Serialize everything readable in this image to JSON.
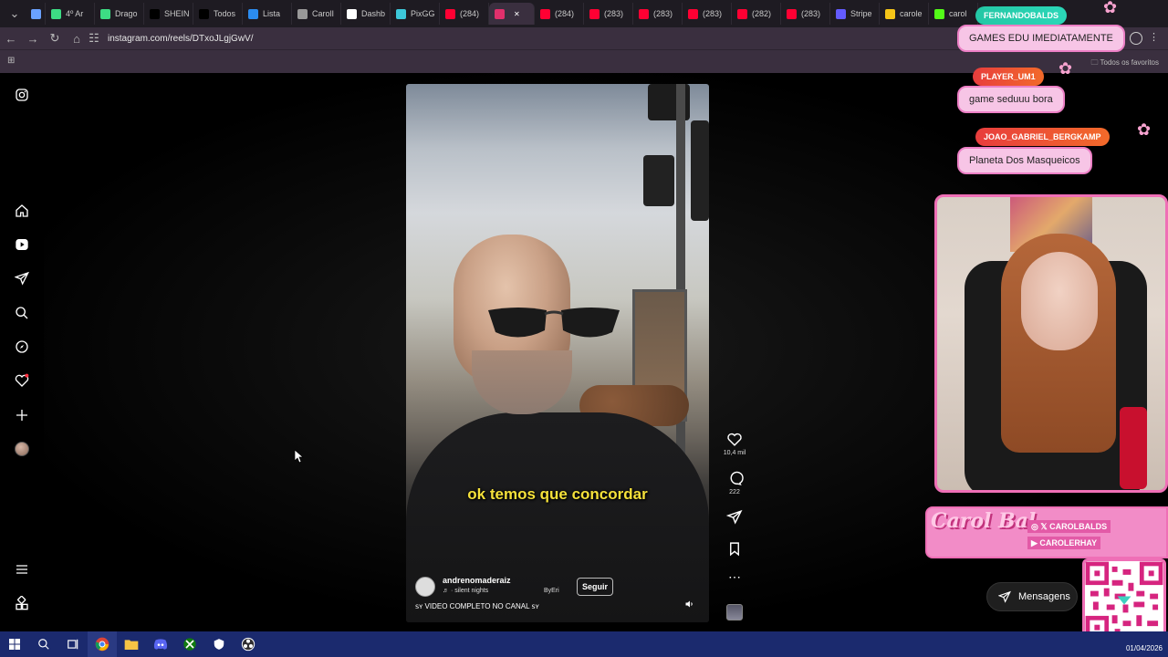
{
  "browser": {
    "tabs": [
      {
        "label": "",
        "color": "#6aa2ff"
      },
      {
        "label": "4º Ar",
        "color": "#3ddc84"
      },
      {
        "label": "Drago",
        "color": "#3ddc84"
      },
      {
        "label": "SHEIN",
        "color": "#000000"
      },
      {
        "label": "Todos",
        "color": "#000000"
      },
      {
        "label": "Lista",
        "color": "#2b8cf0"
      },
      {
        "label": "CarolI",
        "color": "#999999"
      },
      {
        "label": "Dashb",
        "color": "#ffffff"
      },
      {
        "label": "PixGG",
        "color": "#3dc7d9"
      },
      {
        "label": "(284)",
        "color": "#ff0033"
      },
      {
        "label": "",
        "color": "#e1306c"
      },
      {
        "label": "(284)",
        "color": "#ff0033"
      },
      {
        "label": "(283)",
        "color": "#ff0033"
      },
      {
        "label": "(283)",
        "color": "#ff0033"
      },
      {
        "label": "(283)",
        "color": "#ff0033"
      },
      {
        "label": "(282)",
        "color": "#ff0033"
      },
      {
        "label": "(283)",
        "color": "#ff0033"
      },
      {
        "label": "Stripe",
        "color": "#635bff"
      },
      {
        "label": "carole",
        "color": "#f5c518"
      },
      {
        "label": "carol",
        "color": "#53fc18"
      }
    ],
    "url": "instagram.com/reels/DTxoJLgjGwV/",
    "all_favorites": "Todos os favoritos"
  },
  "instagram": {
    "sidebar_icons": [
      "instagram-icon",
      "home-icon",
      "reels-icon",
      "direct-icon",
      "search-icon",
      "explore-icon",
      "notifications-icon",
      "create-icon",
      "profile-avatar",
      "menu-icon",
      "more-icon"
    ],
    "reel": {
      "subtitle": "ok temos que concordar",
      "username": "andrenomaderaiz",
      "music": "♬ · silent nights",
      "byline": "ByEri",
      "follow_label": "Seguir",
      "caption": "ꜱʏ VIDEO COMPLETO NO CANAL ꜱʏ",
      "likes": "10,4 mil",
      "comments": "222"
    },
    "messages_label": "Mensagens"
  },
  "stream_overlay": {
    "chats": [
      {
        "name": "FERNANDOBALDS",
        "message": "GAMES EDU IMEDIATAMENTE"
      },
      {
        "name": "PLAYER_UM1",
        "message": "game seduuu bora"
      },
      {
        "name": "JOAO_GABRIEL_BERGKAMP",
        "message": "Planeta Dos Masqueicos"
      }
    ],
    "brand_logo": "Carol Bal",
    "socials": [
      {
        "network": "X",
        "handle": "CAROLBALDS"
      },
      {
        "network": "YouTube",
        "handle": "CAROLERHAY"
      }
    ],
    "accent_color": "#ef6fb6"
  },
  "taskbar": {
    "date": "01/04/2026"
  }
}
